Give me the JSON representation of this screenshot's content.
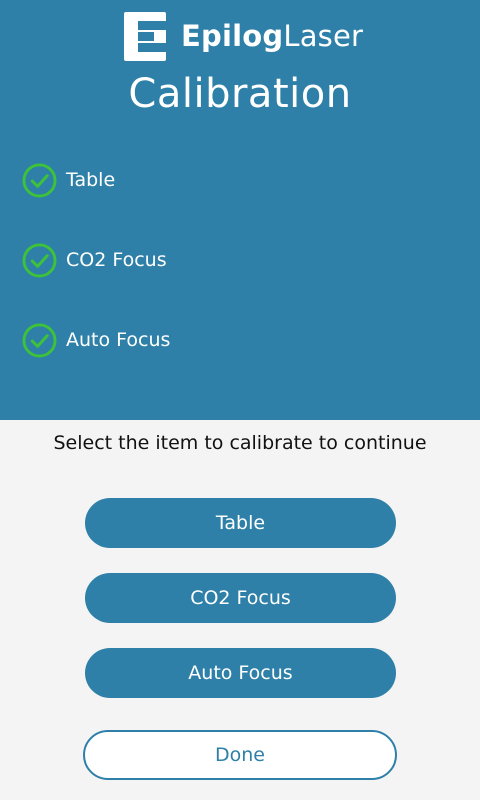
{
  "brand": {
    "logo_bold": "Epilog",
    "logo_light": "Laser"
  },
  "title": "Calibration",
  "status_items": [
    {
      "label": "Table",
      "icon": "check-circle-icon",
      "state": "complete"
    },
    {
      "label": "CO2 Focus",
      "icon": "check-circle-icon",
      "state": "complete"
    },
    {
      "label": "Auto Focus",
      "icon": "check-circle-icon",
      "state": "complete"
    }
  ],
  "instruction": "Select the item to calibrate to continue",
  "buttons": [
    {
      "label": "Table"
    },
    {
      "label": "CO2 Focus"
    },
    {
      "label": "Auto Focus"
    }
  ],
  "done_label": "Done",
  "colors": {
    "primary": "#2e80a8",
    "check": "#3ec23a",
    "background": "#f4f4f4"
  }
}
